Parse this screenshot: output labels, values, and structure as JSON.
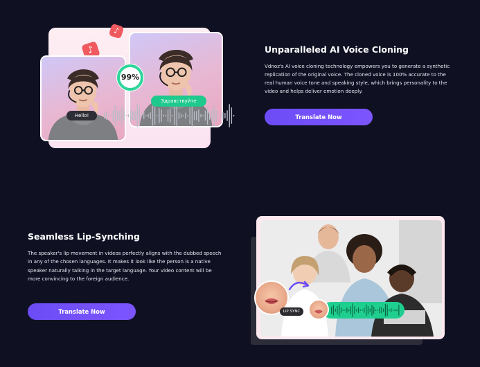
{
  "voice_cloning": {
    "title": "Unparalleled AI Voice Cloning",
    "description": "Vdnoz's AI voice cloning technology empowers you to generate a synthetic replication of the original voice. The cloned voice is 100% accurate to the real human voice tone and speaking style, which brings personality to the video and helps deliver emotion deeply.",
    "button_label": "Translate Now",
    "similarity_badge": "99%",
    "similarity_value": 0.99,
    "source_caption": "Hello!",
    "target_caption": "Здравствуйте"
  },
  "lip_sync": {
    "title": "Seamless Lip-Synching",
    "description": "The speaker's lip movement in videos perfectly aligns with the dubbed speech in any of the chosen languages. It makes it look like the person is a native speaker naturally talking in the target language. Your video content will be more convincing to the foreign audience.",
    "button_label": "Translate Now",
    "badge": "LIP SYNC"
  },
  "icons": [
    "music-note-icon",
    "sound-wave-icon",
    "curved-arrow-icon"
  ],
  "colors": {
    "background": "#0f1123",
    "button": "#6c4cf6",
    "accent_green": "#1ec98e",
    "music_red": "#f05a5f"
  }
}
